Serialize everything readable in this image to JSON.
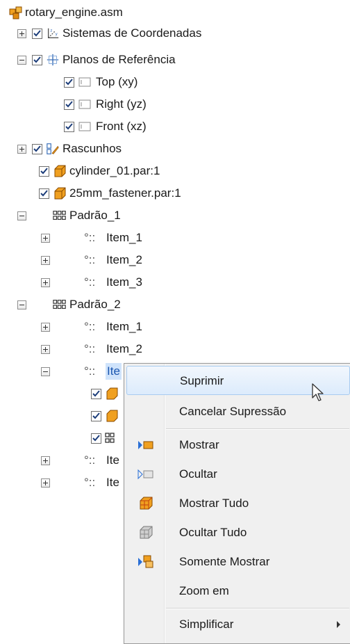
{
  "tree": {
    "root": "rotary_engine.asm",
    "coord_systems": "Sistemas de Coordenadas",
    "ref_planes": "Planos de Referência",
    "plane_top": "Top (xy)",
    "plane_right": "Right (yz)",
    "plane_front": "Front (xz)",
    "sketches": "Rascunhos",
    "part1": "cylinder_01.par:1",
    "part2": "25mm_fastener.par:1",
    "pattern1": "Padrão_1",
    "p1_item1": "Item_1",
    "p1_item2": "Item_2",
    "p1_item3": "Item_3",
    "pattern2": "Padrão_2",
    "p2_item1": "Item_1",
    "p2_item2": "Item_2",
    "p2_item3_partial": "Ite",
    "p2_item4_partial": "Ite",
    "p2_item5_partial": "Ite"
  },
  "context_menu": {
    "suppress": "Suprimir",
    "unsuppress": "Cancelar Supressão",
    "show": "Mostrar",
    "hide": "Ocultar",
    "show_all": "Mostrar Tudo",
    "hide_all": "Ocultar Tudo",
    "show_only": "Somente Mostrar",
    "zoom": "Zoom em",
    "simplify": "Simplificar"
  },
  "colors": {
    "selection_bg": "#cfe3fb",
    "menu_bg": "#f0f0f0",
    "part_orange": "#f0a020",
    "accent_blue": "#1a56b0"
  }
}
